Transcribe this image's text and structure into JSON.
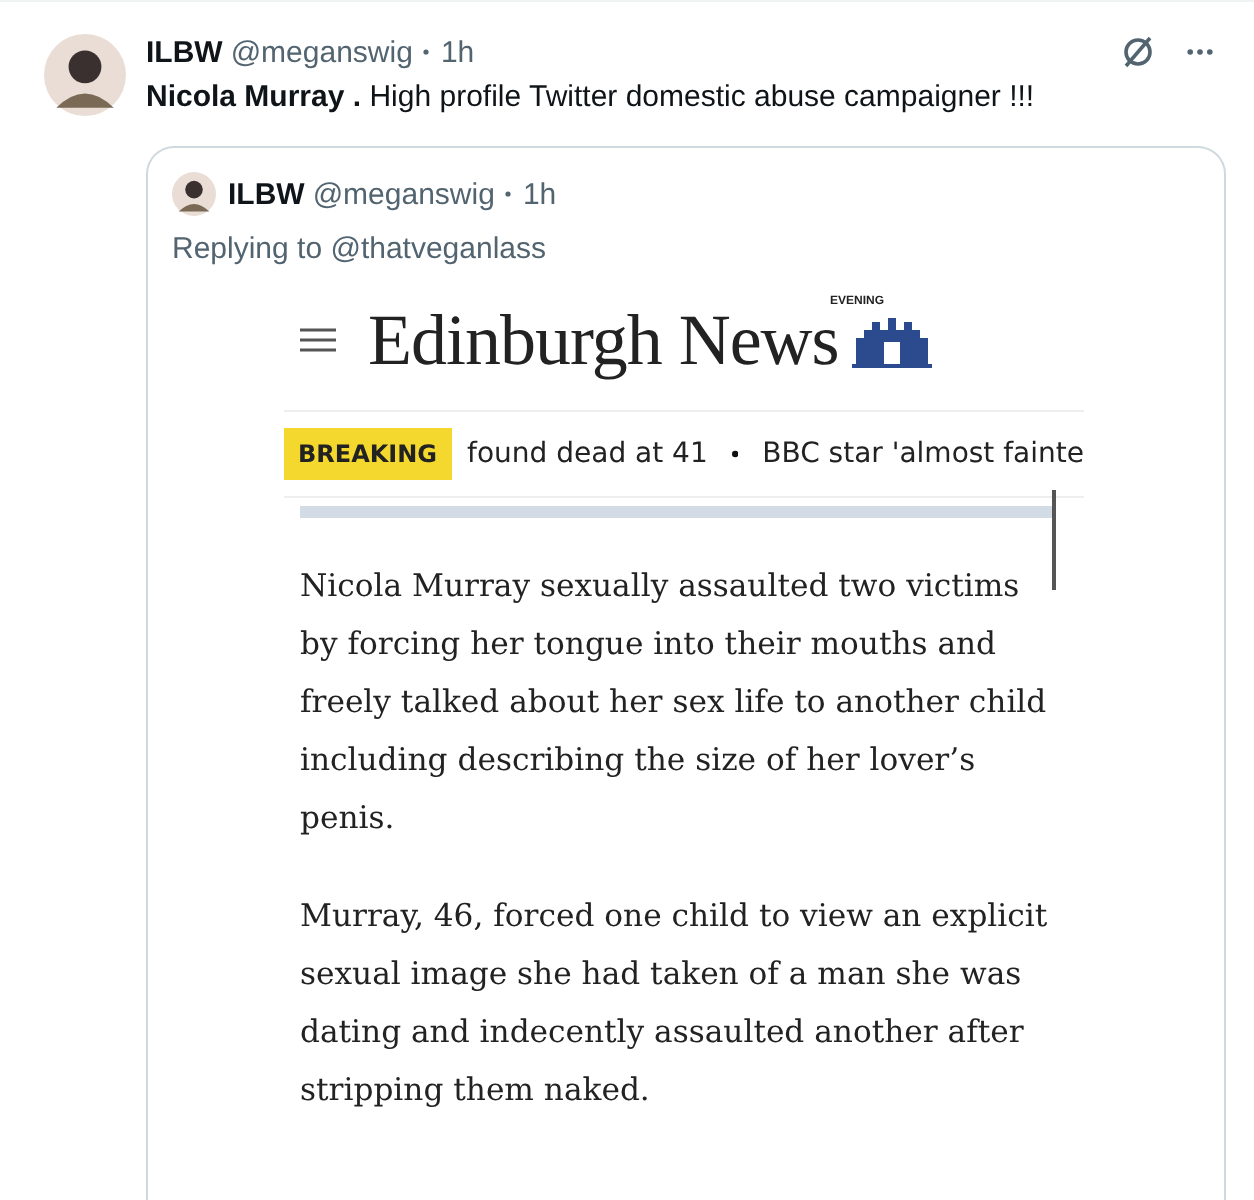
{
  "tweet": {
    "author_name": "ILBW",
    "handle": "@meganswig",
    "time": "1h",
    "text": "**Nicola Murray .** High profile Twitter domestic abuse campaigner !!!",
    "quote": {
      "author_name": "ILBW",
      "handle": "@meganswig",
      "time": "1h",
      "replying_to": "Replying to @thatveganlass",
      "article": {
        "masthead": "Edinburgh News",
        "masthead_small": "EVENING",
        "breaking_label": "BREAKING",
        "ticker": [
          "found dead at 41",
          "BBC star 'almost fainte"
        ],
        "paragraphs": [
          "Nicola Murray sexually assaulted two victims by forcing her tongue into their mouths and freely talked about her sex life to another child including describing the size of her lover’s penis.",
          "Murray, 46, forced one child to view an explicit sexual image she had taken of a man she was dating and indecently assaulted another after stripping them naked."
        ]
      }
    }
  }
}
